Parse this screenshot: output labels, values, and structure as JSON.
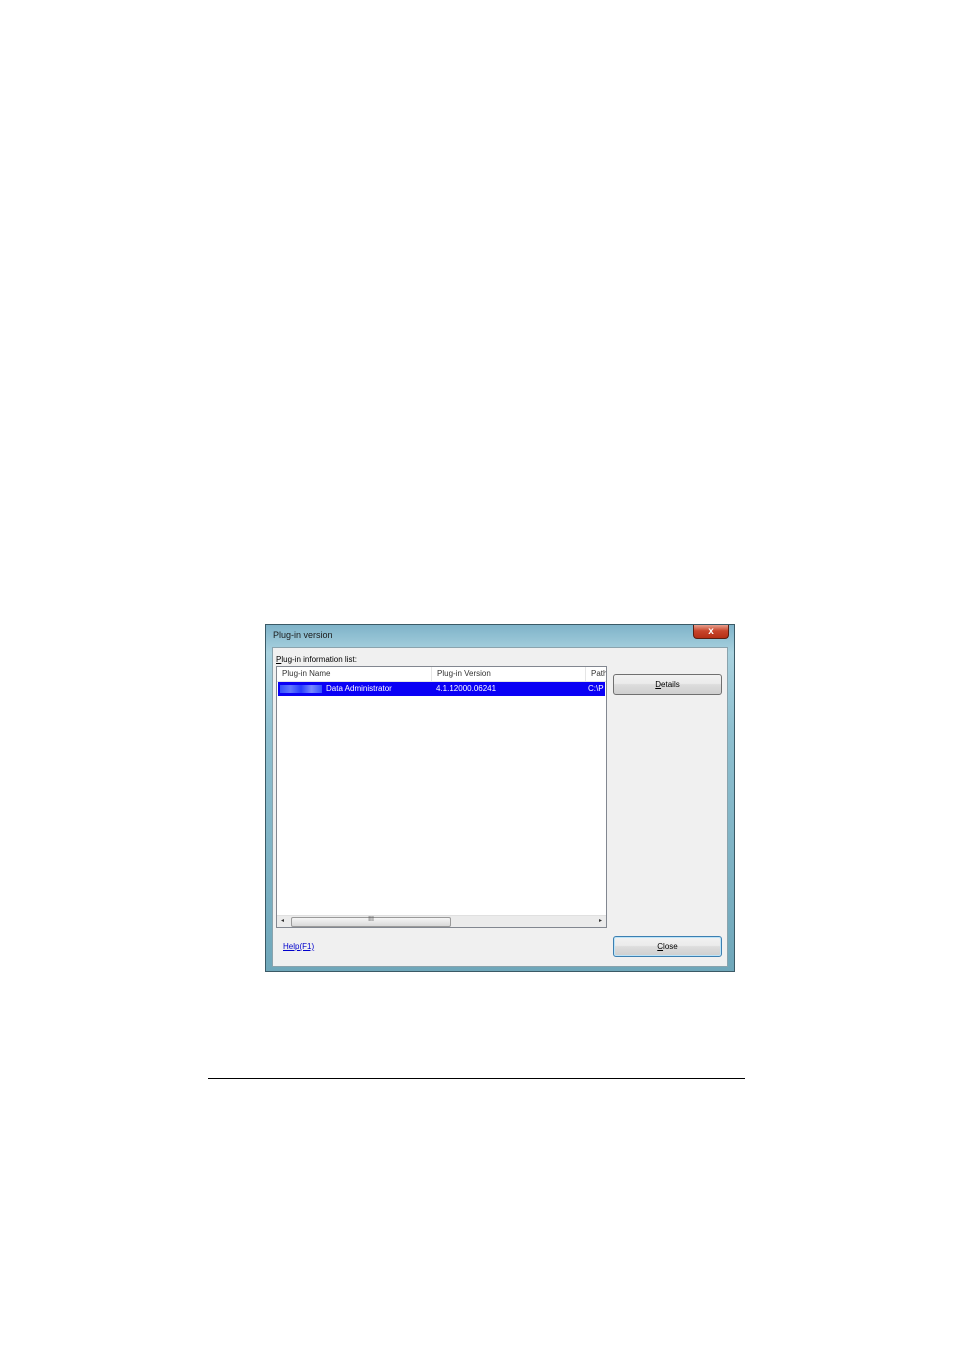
{
  "window": {
    "title": "Plug-in version",
    "close_label": "x"
  },
  "list": {
    "label_accel": "P",
    "label_rest": "lug-in information list:",
    "columns": [
      "Plug-in Name",
      "Plug-in Version",
      "Path"
    ],
    "rows": [
      {
        "name": "Data Administrator",
        "version": "4.1.12000.06241",
        "path": "C:\\P"
      }
    ],
    "scrollbar": {
      "left_arrow": "◂",
      "right_arrow": "▸",
      "grip": "III"
    }
  },
  "buttons": {
    "details_accel": "D",
    "details_rest": "etails",
    "close_accel": "C",
    "close_rest": "lose"
  },
  "help": {
    "label": "Help(F1)"
  },
  "colors": {
    "selection": "#0a00f5",
    "link": "#0000cc"
  }
}
